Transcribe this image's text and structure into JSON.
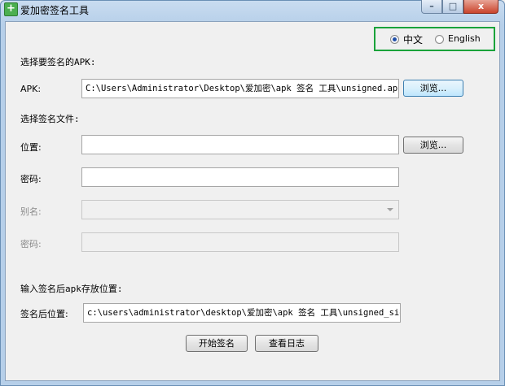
{
  "window": {
    "title": "爱加密签名工具",
    "icon_glyph": "+",
    "minimize_glyph": "–",
    "maximize_glyph": "□",
    "close_glyph": "x"
  },
  "language": {
    "chinese_label": "中文",
    "english_label": "English",
    "selected": "中文"
  },
  "apk_section": {
    "heading": "选择要签名的APK:",
    "apk_label": "APK:",
    "apk_path": "C:\\Users\\Administrator\\Desktop\\爱加密\\apk 签名 工具\\unsigned.apk",
    "browse_label": "浏览..."
  },
  "sign_file_section": {
    "heading": "选择签名文件:",
    "location_label": "位置:",
    "location_value": "",
    "browse_label": "浏览...",
    "password_label": "密码:",
    "password_value": "",
    "alias_label": "别名:",
    "alias_value": "",
    "alias_password_label": "密码:",
    "alias_password_value": ""
  },
  "output_section": {
    "heading": "输入签名后apk存放位置:",
    "output_label": "签名后位置:",
    "output_path": "c:\\users\\administrator\\desktop\\爱加密\\apk 签名 工具\\unsigned_sig"
  },
  "actions": {
    "start_sign_label": "开始签名",
    "view_log_label": "查看日志"
  },
  "colors": {
    "highlight_box": "#1aa33a",
    "title_bar": "#b6cfe9"
  }
}
